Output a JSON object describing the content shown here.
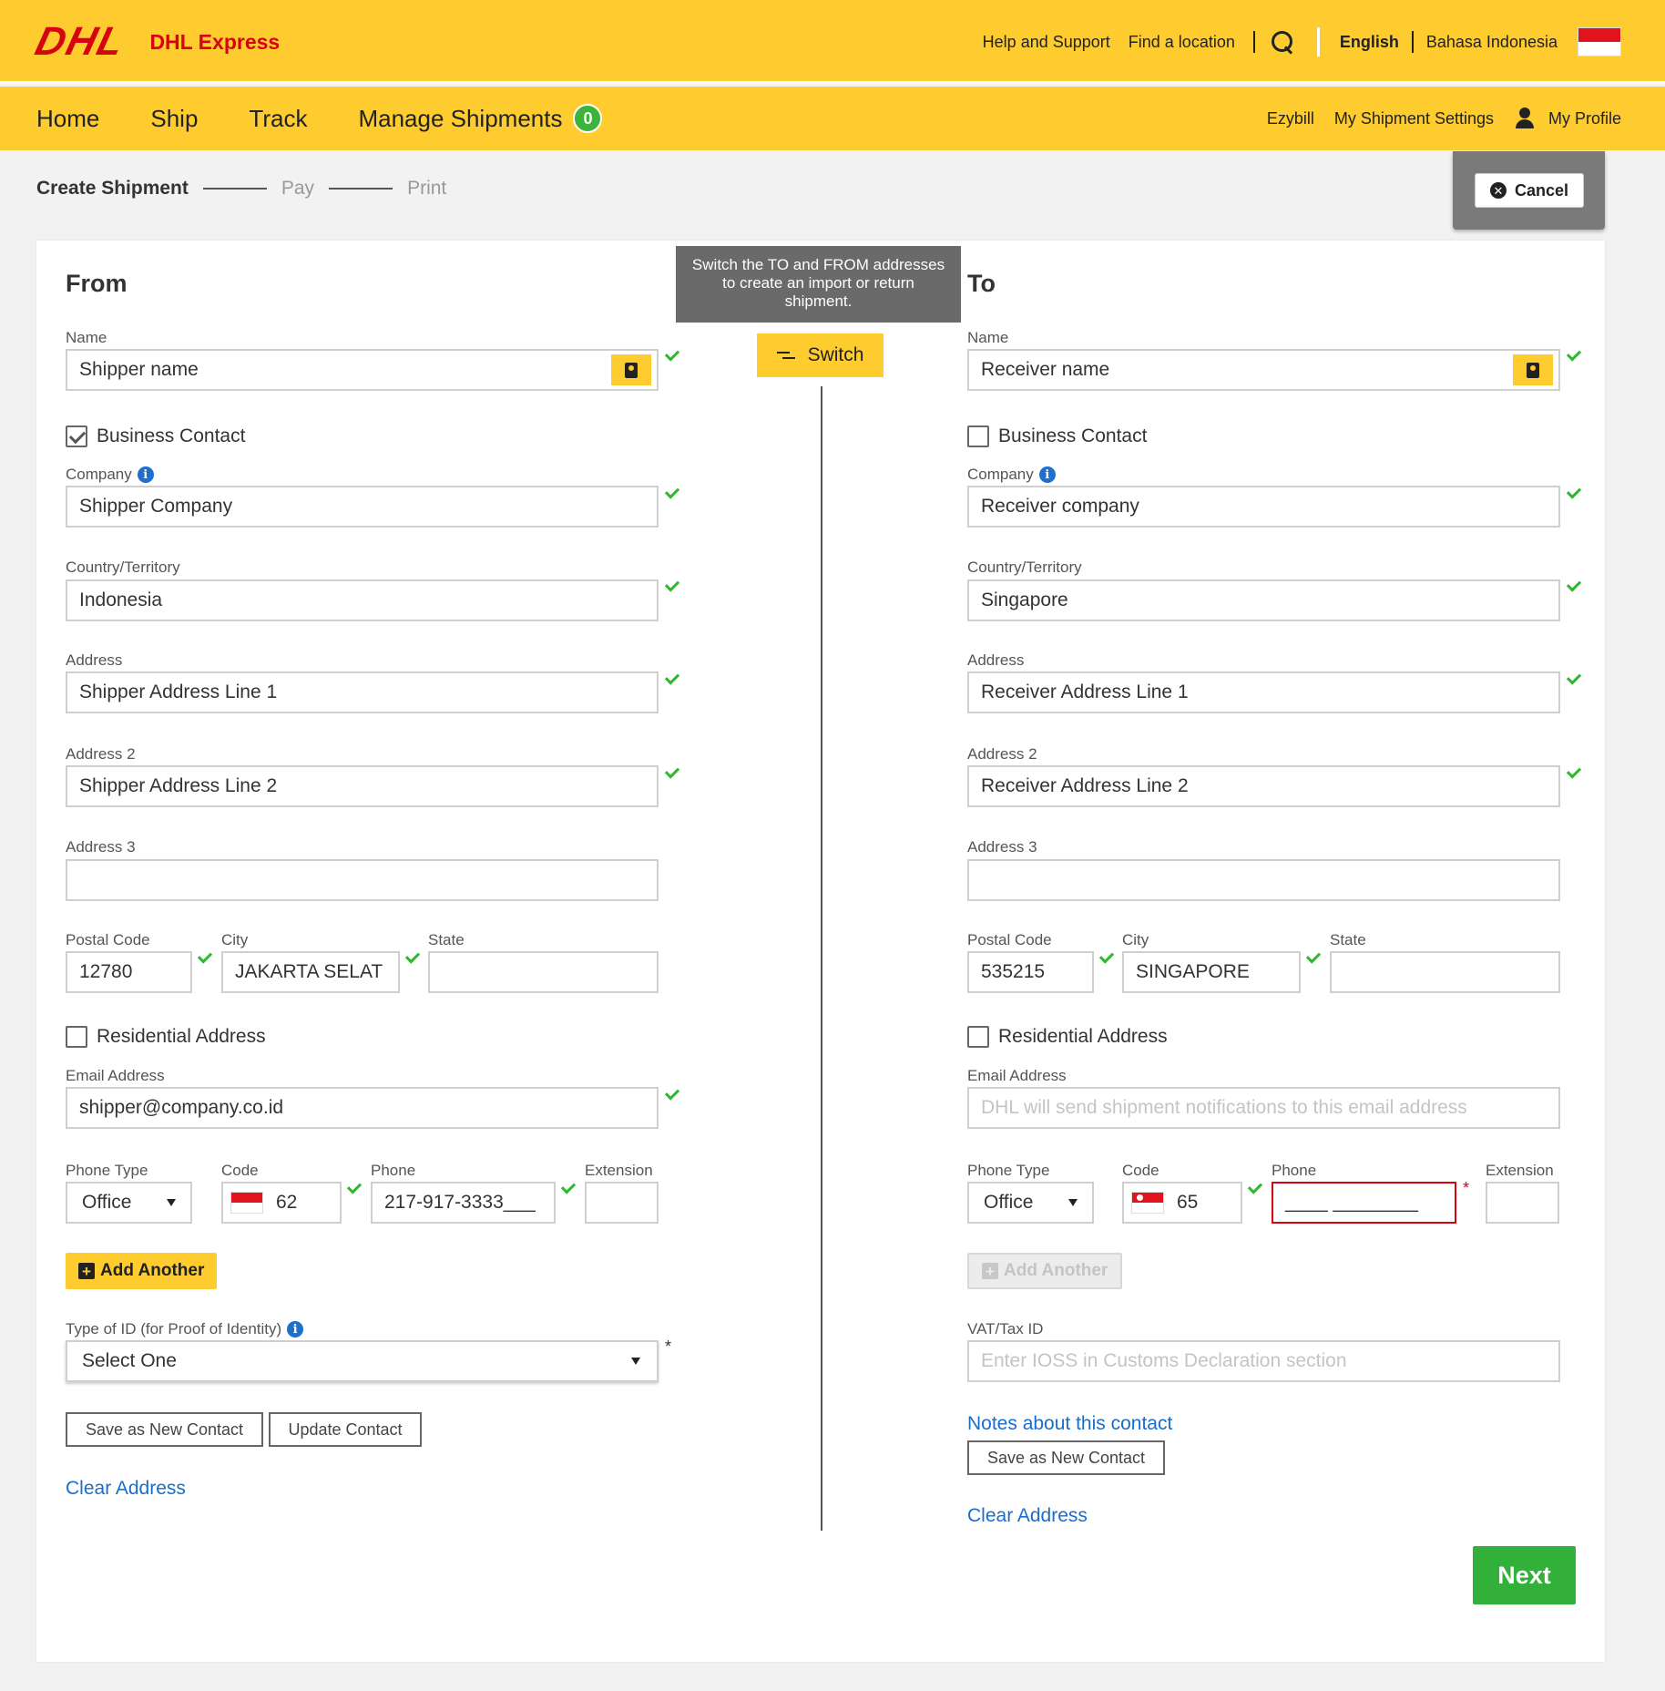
{
  "header": {
    "logo_text": "DHL",
    "brand": "DHL Express",
    "links": {
      "help": "Help and Support",
      "find_location": "Find a location",
      "lang_english": "English",
      "lang_bahasa": "Bahasa Indonesia"
    }
  },
  "nav": {
    "home": "Home",
    "ship": "Ship",
    "track": "Track",
    "manage": "Manage Shipments",
    "manage_count": "0",
    "ezybill": "Ezybill",
    "shipment_settings": "My Shipment Settings",
    "profile": "My Profile"
  },
  "progress": {
    "step1": "Create Shipment",
    "step2": "Pay",
    "step3": "Print",
    "cancel": "Cancel"
  },
  "switch": {
    "tooltip": "Switch the TO and FROM addresses to create an import or return shipment.",
    "label": "Switch"
  },
  "labels": {
    "name": "Name",
    "business_contact": "Business Contact",
    "company": "Company",
    "country": "Country/Territory",
    "address": "Address",
    "address2": "Address 2",
    "address3": "Address 3",
    "postal_code": "Postal Code",
    "city": "City",
    "state": "State",
    "residential": "Residential Address",
    "email": "Email Address",
    "phone_type": "Phone Type",
    "code": "Code",
    "phone": "Phone",
    "extension": "Extension",
    "add_another": "Add Another",
    "id_type": "Type of ID (for Proof of Identity)",
    "vat": "VAT/Tax ID",
    "save_new": "Save as New Contact",
    "update": "Update Contact",
    "clear": "Clear Address",
    "notes": "Notes about this contact"
  },
  "from": {
    "heading": "From",
    "name": "Shipper name",
    "business_contact_checked": true,
    "company": "Shipper Company",
    "country": "Indonesia",
    "address1": "Shipper Address Line 1",
    "address2": "Shipper Address Line 2",
    "address3": "",
    "postal_code": "12780",
    "city": "JAKARTA SELAT",
    "state": "",
    "residential_checked": false,
    "email": "shipper@company.co.id",
    "phone_type": "Office",
    "code": "62",
    "phone": "217-917-3333___",
    "extension": "",
    "id_type": "Select One"
  },
  "to": {
    "heading": "To",
    "name": "Receiver name",
    "business_contact_checked": false,
    "company": "Receiver company",
    "country": "Singapore",
    "address1": "Receiver Address Line 1",
    "address2": "Receiver Address Line 2",
    "address3": "",
    "postal_code": "535215",
    "city": "SINGAPORE",
    "state": "",
    "residential_checked": false,
    "email_placeholder": "DHL will send shipment notifications to this email address",
    "phone_type": "Office",
    "code": "65",
    "phone": "____ ________",
    "extension": "",
    "vat_placeholder": "Enter IOSS in Customs Declaration section"
  },
  "actions": {
    "next": "Next"
  },
  "colors": {
    "brand_yellow": "#fecc2f",
    "brand_red": "#d40511",
    "success_green": "#33b03a",
    "link_blue": "#1a6dc9"
  }
}
